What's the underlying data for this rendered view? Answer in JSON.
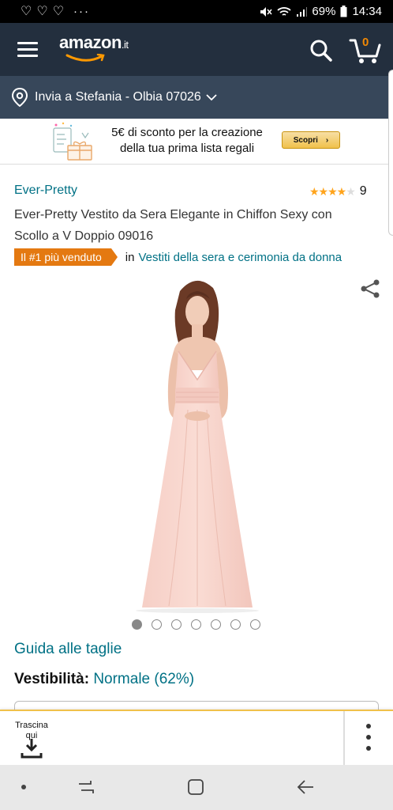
{
  "status_bar": {
    "battery": "69%",
    "time": "14:34",
    "dots": "···"
  },
  "header": {
    "logo_text": "amazon",
    "logo_suffix": ".it",
    "cart_count": "0"
  },
  "delivery": {
    "text": "Invia a Stefania - Olbia 07026"
  },
  "promo": {
    "line1": "5€ di sconto per la creazione",
    "line2": "della tua prima lista regali",
    "button_label": "Scopri",
    "button_arrow": "›"
  },
  "product": {
    "brand": "Ever-Pretty",
    "rating_stars": 4,
    "rating_count": "9",
    "title": "Ever-Pretty Vestito da Sera Elegante in Chiffon Sexy con Scollo a V Doppio 09016",
    "best_seller_badge": "Il #1 più venduto",
    "best_seller_in": "in",
    "best_seller_category": "Vestiti della sera e cerimonia da donna",
    "image_count": 7,
    "active_image_index": 0,
    "size_guide": "Guida alle taglie",
    "fit_label": "Vestibilità:",
    "fit_value": "Normale (62%)"
  },
  "drag_overlay": {
    "label": "Trascina qui"
  },
  "colors": {
    "header_bg": "#232f3e",
    "delivery_bg": "#37475a",
    "link": "#007185",
    "badge": "#e47911",
    "star": "#ffa41c",
    "cart_count": "#f08804"
  }
}
